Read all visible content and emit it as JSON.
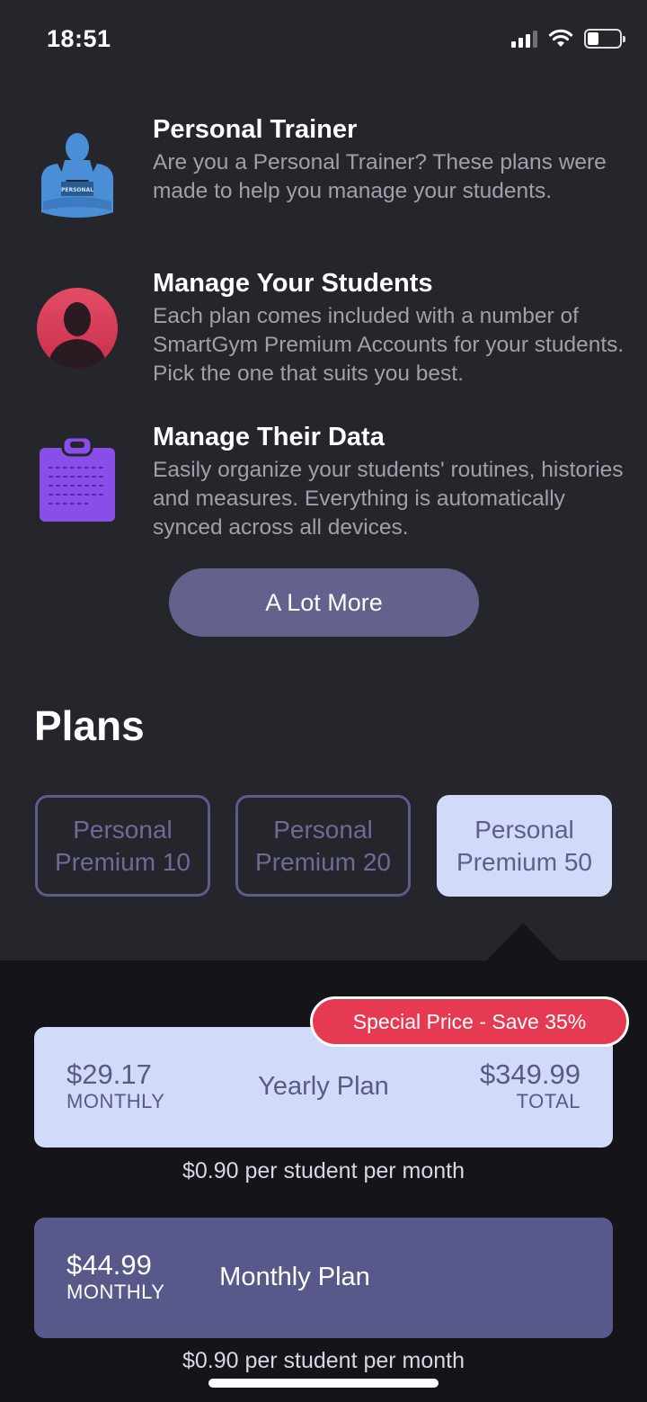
{
  "status_bar": {
    "time": "18:51"
  },
  "features": [
    {
      "icon": "trainer-icon",
      "title": "Personal Trainer",
      "description": "Are you a Personal Trainer? These plans were made to help you manage your students.",
      "icon_label": "PERSONAL"
    },
    {
      "icon": "user-silhouette-icon",
      "title": "Manage Your Students",
      "description": "Each plan comes included with a number of SmartGym Premium Accounts for your students. Pick the one that suits you best."
    },
    {
      "icon": "clipboard-icon",
      "title": "Manage Their Data",
      "description": "Easily organize your students' routines, histories and measures. Everything is automatically synced across all devices."
    }
  ],
  "more_button": "A Lot More",
  "plans_heading": "Plans",
  "plan_tabs": [
    {
      "line1": "Personal",
      "line2": "Premium 10",
      "selected": false
    },
    {
      "line1": "Personal",
      "line2": "Premium 20",
      "selected": false
    },
    {
      "line1": "Personal",
      "line2": "Premium 50",
      "selected": true
    }
  ],
  "badge": "Special Price - Save 35%",
  "yearly": {
    "monthly_price": "$29.17",
    "monthly_label": "MONTHLY",
    "name": "Yearly Plan",
    "total_price": "$349.99",
    "total_label": "TOTAL",
    "per_student": "$0.90 per student per month"
  },
  "monthly": {
    "monthly_price": "$44.99",
    "monthly_label": "MONTHLY",
    "name": "Monthly Plan",
    "per_student": "$0.90 per student per month"
  },
  "colors": {
    "background": "#25252c",
    "accent": "#62628c",
    "selected": "#d2dafa",
    "badge": "#e63a52",
    "trainer_icon": "#4a8fd6",
    "user_icon": "#e04560",
    "clipboard_icon": "#8a4ee8"
  }
}
